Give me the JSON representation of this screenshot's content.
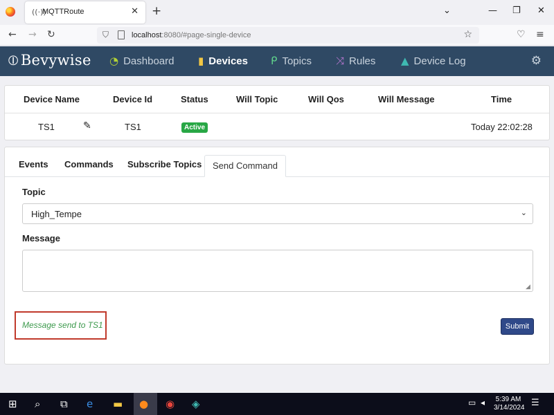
{
  "browser": {
    "tab_title": "MQTTRoute",
    "tab_icon": "((·))",
    "url_host": "localhost",
    "url_rest": ":8080/#page-single-device"
  },
  "app": {
    "brand": "Bevywise",
    "menu": [
      {
        "label": "Dashboard",
        "icon": "dashboard-icon",
        "color": "#b4d335"
      },
      {
        "label": "Devices",
        "icon": "device-icon",
        "color": "#f2c744"
      },
      {
        "label": "Topics",
        "icon": "topic-icon",
        "color": "#5fd18b"
      },
      {
        "label": "Rules",
        "icon": "shuffle-icon",
        "color": "#c07ad8"
      },
      {
        "label": "Device Log",
        "icon": "warning-icon",
        "color": "#3fb9b2"
      }
    ],
    "active_menu": "Devices"
  },
  "device_table": {
    "headers": [
      "Device Name",
      "Device Id",
      "Status",
      "Will Topic",
      "Will Qos",
      "Will Message",
      "Time"
    ],
    "row": {
      "device_name": "TS1",
      "device_id": "TS1",
      "status": "Active",
      "will_topic": "",
      "will_qos": "",
      "will_message": "",
      "time": "Today 22:02:28"
    }
  },
  "detail_tabs": [
    "Events",
    "Commands",
    "Subscribe Topics",
    "Send Command"
  ],
  "active_tab": "Send Command",
  "form": {
    "topic_label": "Topic",
    "topic_value": "High_Tempe",
    "message_label": "Message",
    "message_value": "",
    "status_message": "Message send to TS1",
    "submit_label": "Submit"
  },
  "taskbar": {
    "time": "5:39 AM",
    "date": "3/14/2024"
  },
  "colors": {
    "header_bg": "#2f4964",
    "active_badge": "#28a745",
    "submit_bg": "#2f4989",
    "success_text": "#3d9a4d",
    "highlight_border": "#c0392b"
  }
}
